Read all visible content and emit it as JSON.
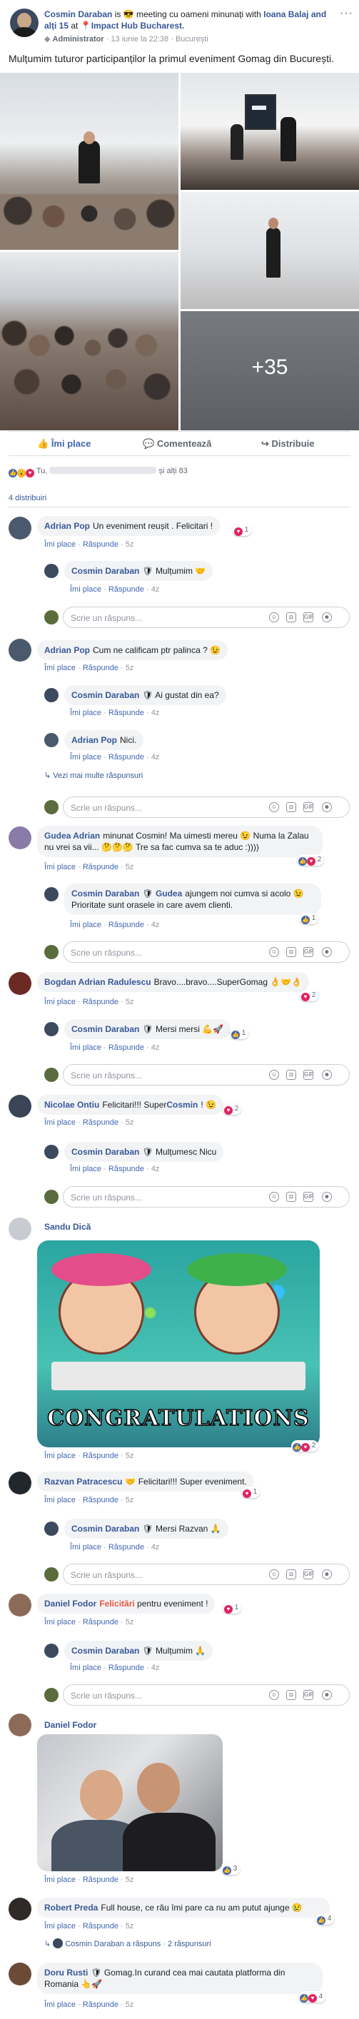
{
  "post": {
    "author": "Cosmin Daraban",
    "is_text": "is",
    "activity": "meeting cu oameni minunați with",
    "tagged": "Ioana Balaj",
    "and_others": "and alți 15",
    "at": "at",
    "place": "Impact Hub Bucharest.",
    "role": "Administrator",
    "date": "13 iunie la 22:38",
    "city": "București",
    "text": "Mulțumim tuturor participanților la primul eveniment Gomag din București.",
    "more_photos": "+35"
  },
  "actions": {
    "like": "Îmi place",
    "comment": "Comentează",
    "share": "Distribuie"
  },
  "reactions": {
    "you": "Tu,",
    "others": "și alți 83",
    "shares": "4 distribuiri"
  },
  "comment_actions": {
    "like": "Îmi place",
    "reply": "Răspunde"
  },
  "reply_placeholder": "Scrie un răspuns...",
  "comments": [
    {
      "name": "Adrian Pop",
      "text": "Un eveniment reușit . Felicitari !",
      "time": "5z",
      "count": "1",
      "reply": {
        "name": "Cosmin Daraban",
        "text": "Mulțumim",
        "time": "4z"
      }
    },
    {
      "name": "Adrian Pop",
      "text": "Cum ne calificam ptr palinca ?",
      "time": "5z",
      "reply": {
        "name": "Cosmin Daraban",
        "text": "Ai gustat din ea?",
        "time": "4z"
      },
      "reply2": {
        "name": "Adrian Pop",
        "text": "Nici.",
        "time": "4z"
      },
      "more": "Vezi mai multe răspunsuri"
    },
    {
      "name": "Gudea Adrian",
      "text": "minunat Cosmin! Ma uimesti mereu 😉 Numa la Zalau nu vrei sa vii... 🤔🤔🤔 Tre sa fac cumva sa te aduc :))))",
      "time": "5z",
      "count": "2",
      "reply": {
        "name": "Cosmin Daraban",
        "tag": "Gudea",
        "text": "ajungem noi cumva si acolo 😉 Prioritate sunt orasele in care avem clienti.",
        "time": "4z",
        "count": "1"
      }
    },
    {
      "name": "Bogdan Adrian Radulescu",
      "text": "Bravo....bravo....SuperGomag",
      "time": "5z",
      "count": "2",
      "reply": {
        "name": "Cosmin Daraban",
        "text": "Mersi mersi",
        "time": "4z",
        "count": "1"
      }
    },
    {
      "name": "Nicolae Ontiu",
      "text": "Felicitari!!! Super",
      "text_tag": "Cosmin",
      "text_end": "!",
      "time": "5z",
      "count": "2",
      "reply": {
        "name": "Cosmin Daraban",
        "text": "Mulțumesc Nicu",
        "time": "4z"
      }
    },
    {
      "name": "Sandu Dică",
      "gif_text": "CONGRATULATIONS",
      "time": "5z",
      "count": "2"
    },
    {
      "name": "Razvan Patracescu",
      "text": "Felicitari!!! Super eveniment.",
      "time": "5z",
      "count": "1",
      "reply": {
        "name": "Cosmin Daraban",
        "text": "Mersi Razvan",
        "time": "4z"
      }
    },
    {
      "name": "Daniel Fodor",
      "text_tag": "Felicitări",
      "text": "pentru eveniment !",
      "time": "5z",
      "count": "1",
      "reply": {
        "name": "Cosmin Daraban",
        "text": "Mulțumim",
        "time": "4z"
      }
    },
    {
      "name": "Daniel Fodor",
      "time": "5z",
      "count": "3"
    },
    {
      "name": "Robert Preda",
      "text": "Full house, ce rău îmi pare ca nu am putut ajunge",
      "time": "5z",
      "count": "4",
      "replied": "Cosmin Daraban a răspuns",
      "replies": "2 răspunsuri"
    },
    {
      "name": "Doru Rusti",
      "text": "Gomag.In curand cea mai cautata platforma din Romania",
      "time": "5z",
      "count": "4"
    }
  ],
  "colors": {
    "link": "#385898",
    "accent": "#4267b2",
    "bubble": "#f2f3f5",
    "love": "#e0245e"
  }
}
